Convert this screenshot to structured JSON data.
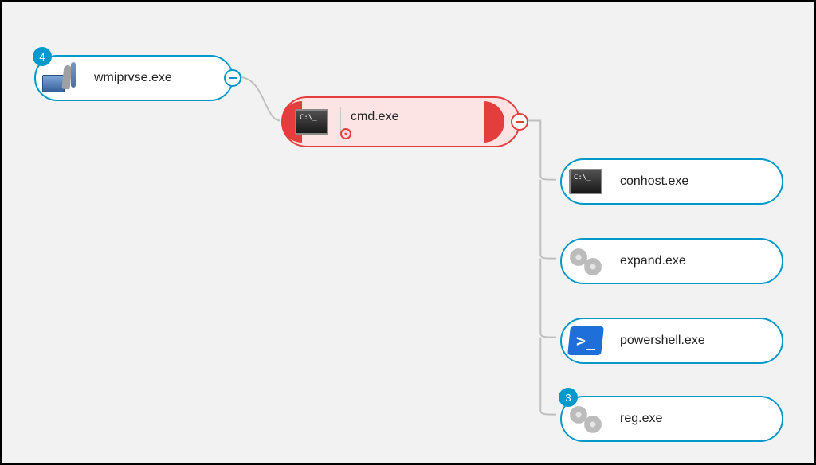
{
  "tree": {
    "root": {
      "label": "wmiprvse.exe",
      "badge": "4",
      "icon": "wmi",
      "collapsible": true,
      "children": [
        {
          "label": "cmd.exe",
          "icon": "cmd",
          "malicious": true,
          "collapsible": true,
          "children": [
            {
              "label": "conhost.exe",
              "icon": "cmd"
            },
            {
              "label": "expand.exe",
              "icon": "gears"
            },
            {
              "label": "powershell.exe",
              "icon": "ps"
            },
            {
              "label": "reg.exe",
              "icon": "gears",
              "badge": "3"
            }
          ]
        }
      ]
    }
  },
  "colors": {
    "node_border": "#0099cc",
    "malicious": "#e43d3d",
    "background": "#f2f2f2"
  }
}
